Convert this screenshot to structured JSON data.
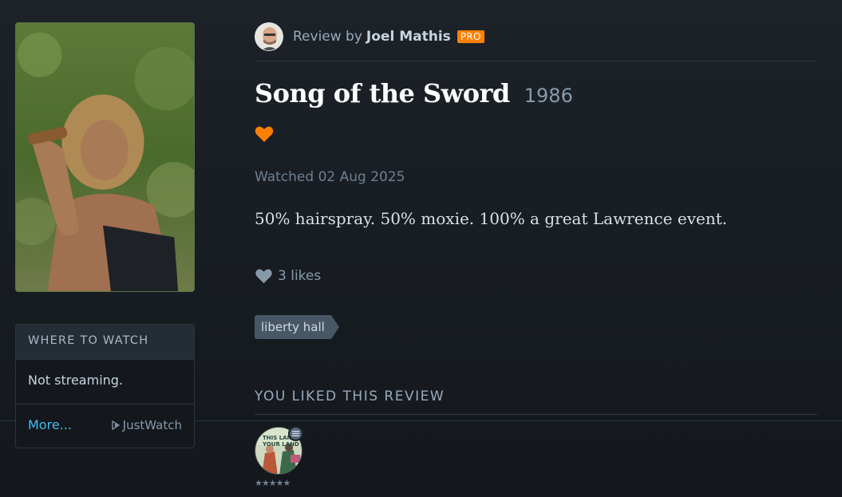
{
  "review": {
    "by_label": "Review by",
    "author": "Joel Mathis",
    "badge": "PRO",
    "film_title": "Song of the Sword",
    "film_year": "1986",
    "watched": "Watched 02 Aug 2025",
    "text": "50% hairspray. 50% moxie. 100% a great Lawrence event.",
    "likes": "3 likes",
    "tag": "liberty hall",
    "liked": true
  },
  "where_to_watch": {
    "heading": "WHERE TO WATCH",
    "status": "Not streaming.",
    "more_link": "More...",
    "provider": "JustWatch"
  },
  "liked_section": {
    "heading": "YOU LIKED THIS REVIEW",
    "liker_stars": "★★★★★",
    "liker_avatar_text": "THIS LAND YOUR LAND"
  },
  "colors": {
    "accent_orange": "#ff8000",
    "link_blue": "#40bcf4",
    "background": "#14181c"
  },
  "icons": {
    "heart": "heart-icon",
    "likes_heart": "likes-heart-icon",
    "justwatch": "justwatch-play-icon",
    "list": "list-icon"
  }
}
